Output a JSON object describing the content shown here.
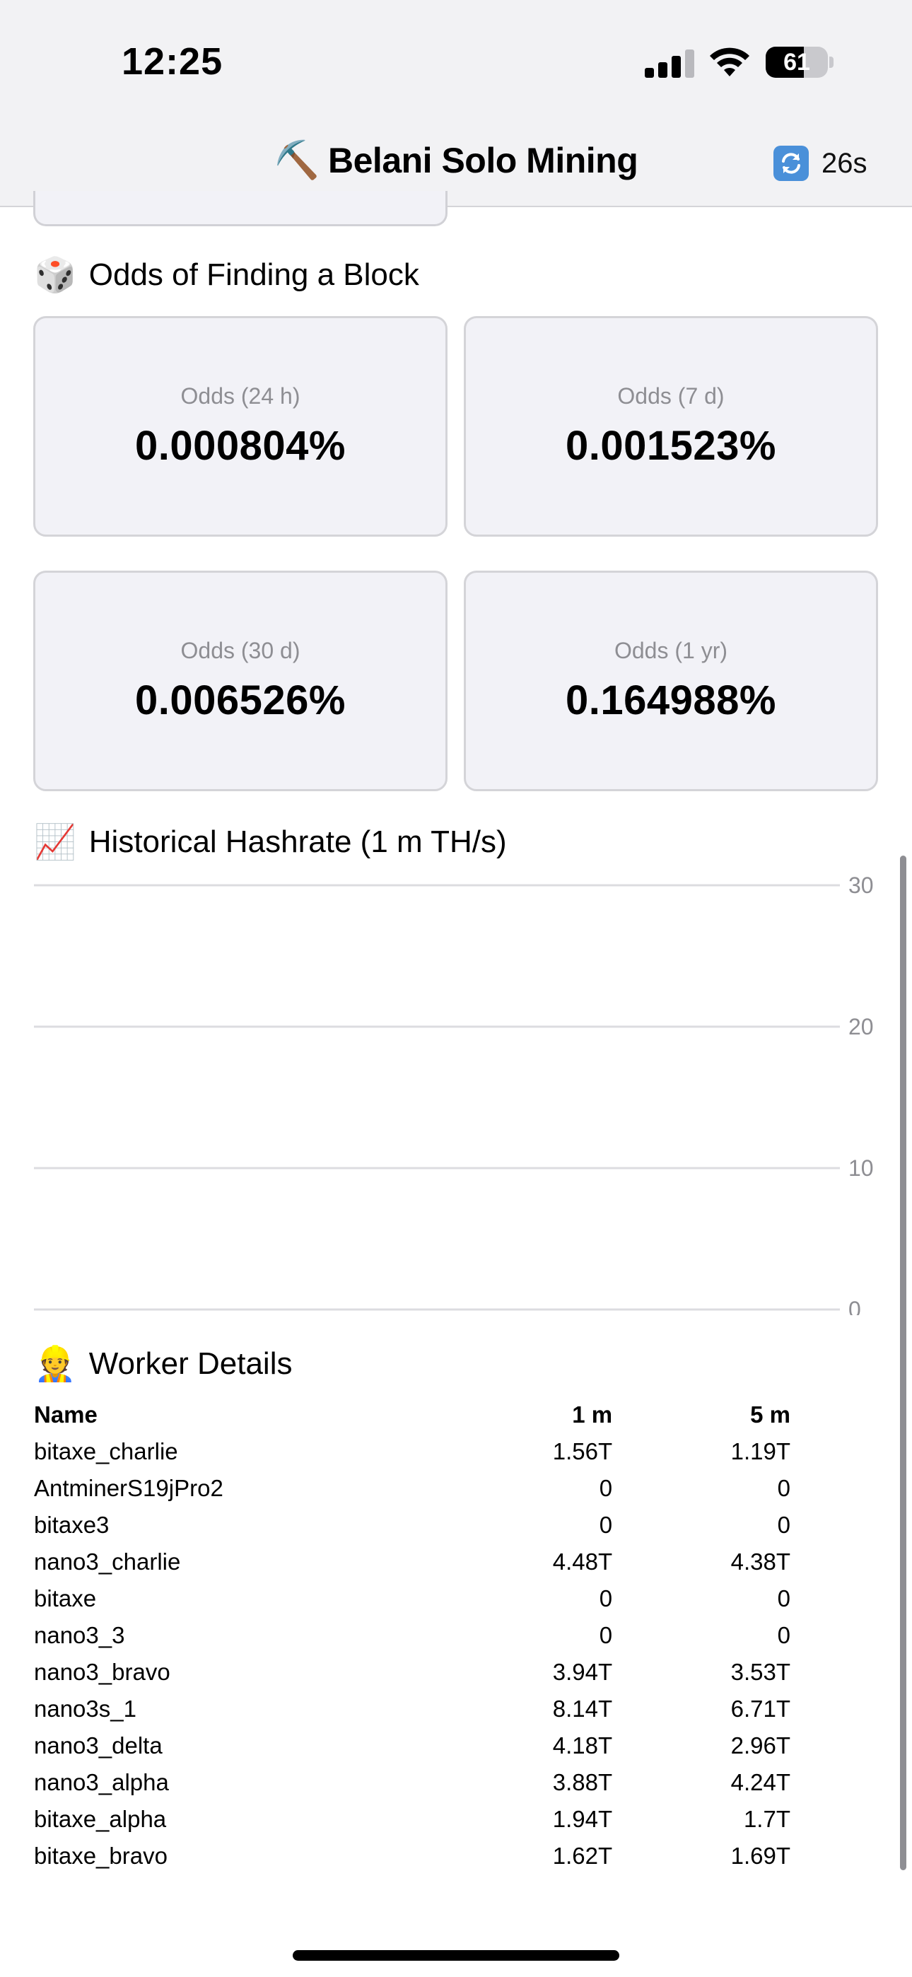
{
  "status_bar": {
    "time": "12:25",
    "battery": "61"
  },
  "header": {
    "icon": "pick-icon",
    "title": "Belani Solo Mining",
    "refresh_icon": "refresh-icon",
    "refresh_countdown": "26s"
  },
  "odds_section": {
    "icon": "dice-icon",
    "title": "Odds of Finding a Block",
    "cards": [
      {
        "label": "Odds (24 h)",
        "value": "0.000804%"
      },
      {
        "label": "Odds (7 d)",
        "value": "0.001523%"
      },
      {
        "label": "Odds (30 d)",
        "value": "0.006526%"
      },
      {
        "label": "Odds (1 yr)",
        "value": "0.164988%"
      }
    ]
  },
  "hashrate_section": {
    "icon": "chart-increasing-icon",
    "title": "Historical Hashrate (1 m TH/s)"
  },
  "chart_data": {
    "type": "line",
    "title": "",
    "xlabel": "",
    "ylabel": "",
    "ylim": [
      0,
      30
    ],
    "yticks": [
      0,
      10,
      20,
      30
    ],
    "grid": true,
    "series": []
  },
  "workers_section": {
    "icon": "construction-worker-icon",
    "title": "Worker Details",
    "columns": [
      "Name",
      "1 m",
      "5 m"
    ],
    "rows": [
      [
        "bitaxe_charlie",
        "1.56T",
        "1.19T"
      ],
      [
        "AntminerS19jPro2",
        "0",
        "0"
      ],
      [
        "bitaxe3",
        "0",
        "0"
      ],
      [
        "nano3_charlie",
        "4.48T",
        "4.38T"
      ],
      [
        "bitaxe",
        "0",
        "0"
      ],
      [
        "nano3_3",
        "0",
        "0"
      ],
      [
        "nano3_bravo",
        "3.94T",
        "3.53T"
      ],
      [
        "nano3s_1",
        "8.14T",
        "6.71T"
      ],
      [
        "nano3_delta",
        "4.18T",
        "2.96T"
      ],
      [
        "nano3_alpha",
        "3.88T",
        "4.24T"
      ],
      [
        "bitaxe_alpha",
        "1.94T",
        "1.7T"
      ],
      [
        "bitaxe_bravo",
        "1.62T",
        "1.69T"
      ]
    ]
  },
  "colors": {
    "card_bg": "#f2f2f7",
    "card_border": "#d4d4d8",
    "muted_text": "#8e8e93",
    "header_bg": "#f2f2f4",
    "refresh_blue": "#4a90d9"
  }
}
